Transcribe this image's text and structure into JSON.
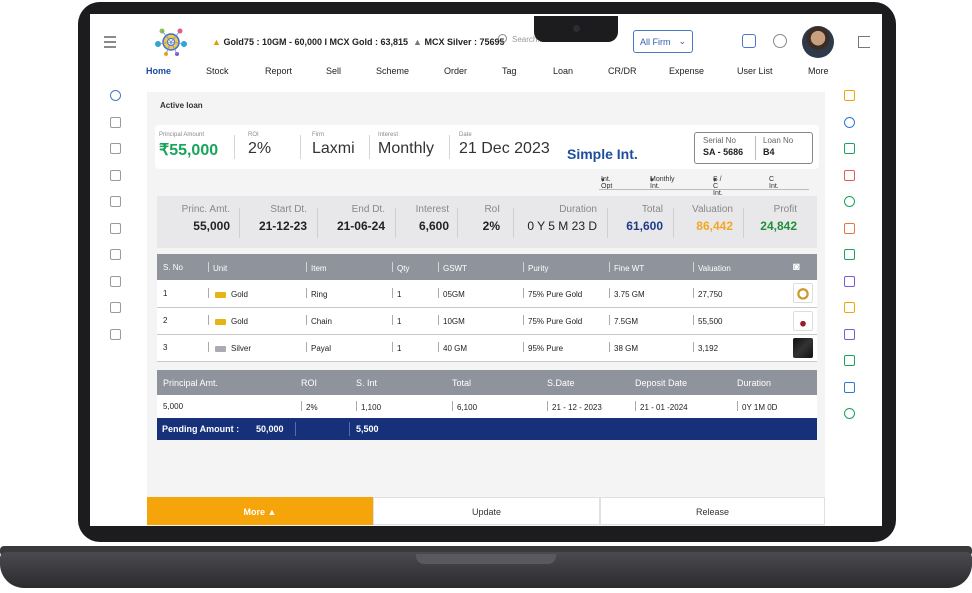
{
  "ticker": {
    "gold75": "Gold75 : 10GM - 60,000",
    "mcx_gold": " I MCX Gold : 63,815",
    "mcx_silver": "MCX Silver : 75695"
  },
  "search": {
    "placeholder": "Search..."
  },
  "firm_select": {
    "value": "All Firm"
  },
  "nav": [
    "Home",
    "Stock",
    "Report",
    "Sell",
    "Scheme",
    "Order",
    "Tag",
    "Loan",
    "CR/DR",
    "Expense",
    "User List",
    "More"
  ],
  "page_title": "Active loan",
  "summary": {
    "principal_label": "Principal Amount",
    "principal_currency": "₹",
    "principal_value": "55,000",
    "roi_label": "ROI",
    "roi_value": "2%",
    "firm_label": "Firm",
    "firm_value": "Laxmi",
    "interest_label": "Interest",
    "interest_value": "Monthly",
    "date_label": "Date",
    "date_value": "21 Dec 2023",
    "interest_type": "Simple Int.",
    "serial_label": "Serial No",
    "serial_value": "SA - 5686",
    "loan_label": "Loan No",
    "loan_value": "B4"
  },
  "filters": {
    "int_opt": "Int. Opt",
    "monthly": "Monthly Int.",
    "sc_int": "S / C Int.",
    "c_int": "C Int."
  },
  "stats": {
    "princ_label": "Princ. Amt.",
    "princ_value": "55,000",
    "start_label": "Start Dt.",
    "start_value": "21-12-23",
    "end_label": "End Dt.",
    "end_value": "21-06-24",
    "interest_label": "Interest",
    "interest_value": "6,600",
    "roi_label": "RoI",
    "roi_value": "2%",
    "duration_label": "Duration",
    "duration_value": "0 Y 5 M 23 D",
    "total_label": "Total",
    "total_value": "61,600",
    "valuation_label": "Valuation",
    "valuation_value": "86,442",
    "profit_label": "Profit",
    "profit_value": "24,842"
  },
  "items_table": {
    "headers": [
      "S. No",
      "Unit",
      "Item",
      "Qty",
      "GSWT",
      "Purity",
      "Fine WT",
      "Valuation"
    ],
    "rows": [
      {
        "sno": "1",
        "unit": "Gold",
        "item": "Ring",
        "qty": "1",
        "gswt": "05GM",
        "purity": "75% Pure Gold",
        "fine": "3.75 GM",
        "valuation": "27,750",
        "metal": "gold"
      },
      {
        "sno": "2",
        "unit": "Gold",
        "item": "Chain",
        "qty": "1",
        "gswt": "10GM",
        "purity": "75% Pure Gold",
        "fine": "7.5GM",
        "valuation": "55,500",
        "metal": "gold"
      },
      {
        "sno": "3",
        "unit": "Silver",
        "item": "Payal",
        "qty": "1",
        "gswt": "40 GM",
        "purity": "95% Pure",
        "fine": "38 GM",
        "valuation": "3,192",
        "metal": "silver"
      }
    ]
  },
  "loan_table": {
    "headers": [
      "Principal Amt.",
      "ROI",
      "S. Int",
      "Total",
      "S.Date",
      "Deposit Date",
      "Duration"
    ],
    "row": [
      "5,000",
      "2%",
      "1,100",
      "6,100",
      "21 - 12 - 2023",
      "21 - 01 -2024",
      "0Y 1M 0D"
    ]
  },
  "pending": {
    "label": "Pending Amount :",
    "value": "50,000",
    "int": "5,500"
  },
  "footer": {
    "more": "More",
    "update": "Update",
    "release": "Release"
  },
  "colors": {
    "primary_blue": "#1d4e9e",
    "accent_orange": "#f5a40a",
    "green": "#1aa35c",
    "pending_bg": "#16307a"
  }
}
